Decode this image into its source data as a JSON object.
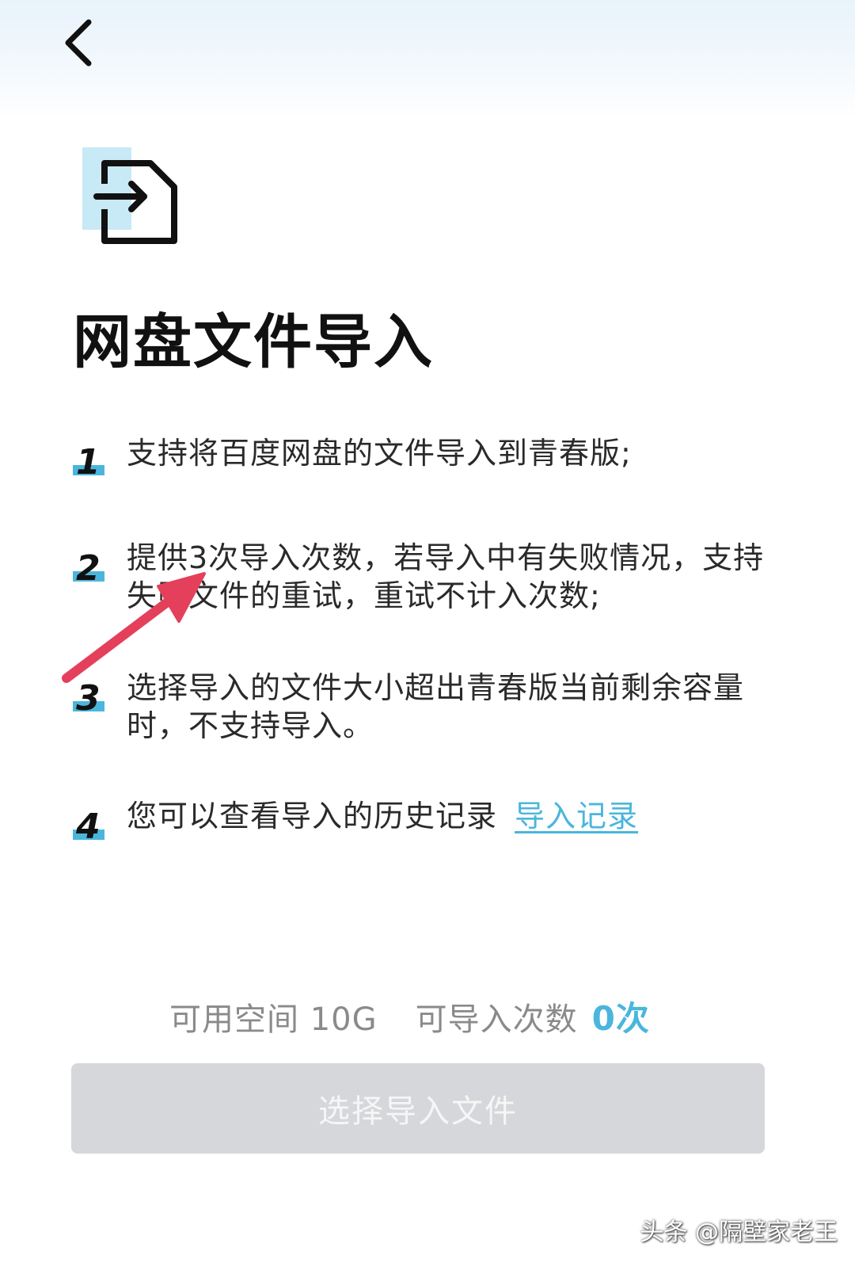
{
  "title": "网盘文件导入",
  "steps": [
    {
      "num": "1",
      "text": "支持将百度网盘的文件导入到青春版;"
    },
    {
      "num": "2",
      "text": "提供3次导入次数，若导入中有失败情况，支持失败文件的重试，重试不计入次数;"
    },
    {
      "num": "3",
      "text": "选择导入的文件大小超出青春版当前剩余容量时，不支持导入。"
    },
    {
      "num": "4",
      "text": "您可以查看导入的历史记录",
      "link": "导入记录"
    }
  ],
  "stats": {
    "space_label": "可用空间 10G",
    "count_label": "可导入次数",
    "count_value": "0次"
  },
  "button_label": "选择导入文件",
  "watermark": "头条 @隔壁家老王",
  "colors": {
    "accent": "#4bb6dc",
    "button_disabled": "#d6d7da",
    "annotation_arrow": "#e4405b"
  },
  "icons": {
    "back": "chevron-left-icon",
    "file_import": "file-import-icon"
  }
}
